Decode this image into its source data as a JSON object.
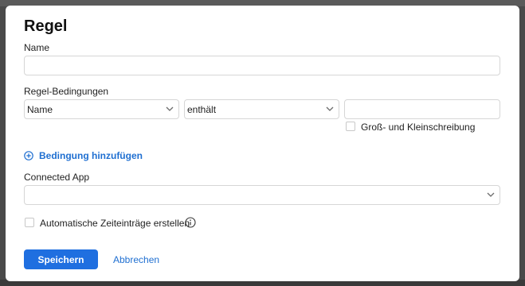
{
  "dialog": {
    "title": "Regel",
    "name_label": "Name",
    "name_value": "",
    "conditions_label": "Regel-Bedingungen",
    "condition": {
      "field": "Name",
      "operator": "enthält",
      "value": "",
      "case_sensitive_label": "Groß- und Kleinschreibung",
      "case_sensitive": false
    },
    "add_condition_label": "Bedingung hinzufügen",
    "connected_app_label": "Connected App",
    "connected_app_value": "",
    "auto_time_entries_label": "Automatische Zeiteinträge erstellen",
    "auto_time_entries": false,
    "save_label": "Speichern",
    "cancel_label": "Abbrechen"
  },
  "colors": {
    "accent": "#1f6fe0",
    "link": "#1f6fd1",
    "border": "#d6d6d6",
    "backdrop": "#4a4a4a"
  },
  "icons": {
    "add_condition": "plus-circle-icon",
    "select_arrow": "chevron-down-icon",
    "info": "info-icon"
  }
}
